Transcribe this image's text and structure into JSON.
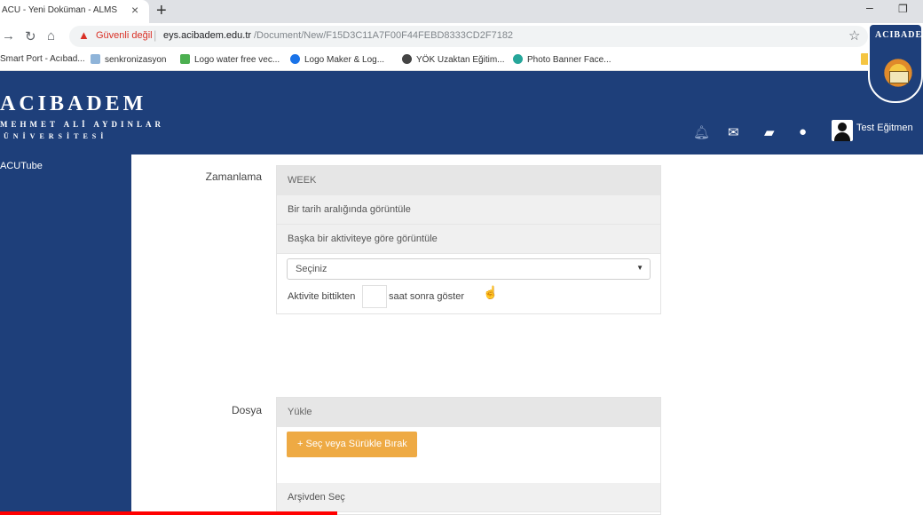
{
  "browser": {
    "tab_title": "ACU - Yeni Doküman - ALMS",
    "security_label": "Güvenli değil",
    "url_host": "eys.acibadem.edu.tr",
    "url_path": "/Document/New/F15D3C11A7F00F44FEBD8333CD2F7182"
  },
  "bookmarks": [
    {
      "label": "Smart Port - Acıbad...",
      "color": "#6aa84f"
    },
    {
      "label": "senkronizasyon",
      "color": "#8fb4d9"
    },
    {
      "label": "Logo water free vec...",
      "color": "#4caf50"
    },
    {
      "label": "Logo Maker & Log...",
      "color": "#1a73e8"
    },
    {
      "label": "YÖK Uzaktan Eğitim...",
      "color": "#444444"
    },
    {
      "label": "Photo Banner Face...",
      "color": "#26a69a"
    }
  ],
  "header": {
    "logo_main": "ACIBADEM",
    "logo_sub1": "MEHMET ALİ AYDINLAR",
    "logo_sub2": "ÜNİVERSİTESİ",
    "badge_text": "ACIBADEM",
    "user_name": "Test Eğitmen"
  },
  "sidebar": {
    "items": [
      {
        "label": "ACUTube"
      }
    ]
  },
  "scheduling": {
    "label": "Zamanlama",
    "options": [
      {
        "label": "WEEK"
      },
      {
        "label": "Bir tarih aralığında görüntüle"
      },
      {
        "label": "Başka bir aktiviteye göre görüntüle"
      }
    ],
    "select_value": "Seçiniz",
    "delay_label": "Aktivite bittikten",
    "delay_value": "",
    "delay_suffix": "saat sonra göster"
  },
  "file": {
    "label": "Dosya",
    "upload_header": "Yükle",
    "upload_button": "+ Seç veya Sürükle Bırak",
    "archive_option": "Arşivden Seç"
  },
  "colors": {
    "brand_navy": "#1e3f7a",
    "upload_orange": "#eeaa44",
    "warning_red": "#d93025"
  }
}
